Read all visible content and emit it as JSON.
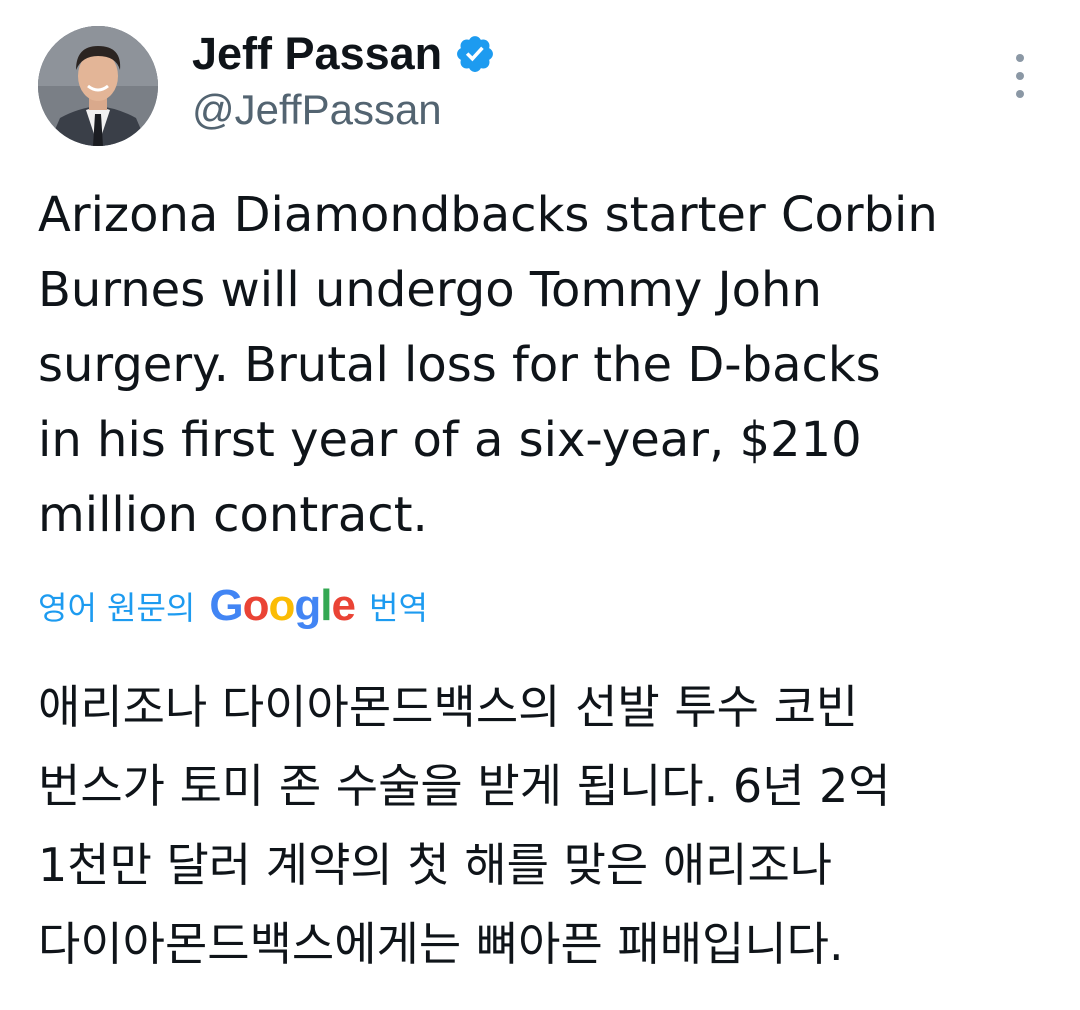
{
  "author": {
    "display_name": "Jeff Passan",
    "handle": "@JeffPassan",
    "verified": true,
    "avatar_icon": "profile-photo"
  },
  "menu": {
    "icon": "more-vertical-icon"
  },
  "tweet": {
    "lines": [
      "Arizona Diamondbacks starter Corbin",
      "Burnes will undergo Tommy John",
      "surgery. Brutal loss for the D-backs",
      "in his first year of a six-year, $210",
      "million contract."
    ]
  },
  "translation": {
    "prefix": "영어 원문의",
    "provider_letters": [
      "G",
      "o",
      "o",
      "g",
      "l",
      "e"
    ],
    "provider_colors": [
      "#4285F4",
      "#EA4335",
      "#FBBC05",
      "#4285F4",
      "#34A853",
      "#EA4335"
    ],
    "suffix": "번역",
    "lines": [
      "애리조나 다이아몬드백스의 선발 투수 코빈",
      "번스가 토미 존 수술을 받게 됩니다. 6년 2억",
      "1천만 달러 계약의 첫 해를 맞은 애리조나",
      "다이아몬드백스에게는 뼈아픈 패배입니다."
    ]
  },
  "colors": {
    "text": "#0f1419",
    "secondary": "#536471",
    "link": "#1d9bf0",
    "verified": "#1d9bf0"
  }
}
